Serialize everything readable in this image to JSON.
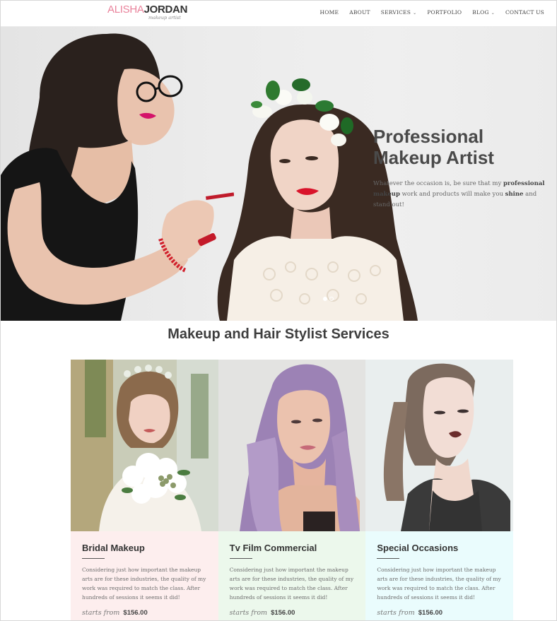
{
  "header": {
    "logo_first": "ALISHA",
    "logo_last": "JORDAN",
    "logo_tagline": "makeup artist",
    "nav": [
      {
        "label": "HOME",
        "dropdown": false
      },
      {
        "label": "ABOUT",
        "dropdown": false
      },
      {
        "label": "SERVICES",
        "dropdown": true
      },
      {
        "label": "PORTFOLIO",
        "dropdown": false
      },
      {
        "label": "BLOG",
        "dropdown": true
      },
      {
        "label": "CONTACT US",
        "dropdown": false
      }
    ]
  },
  "hero": {
    "title_line1": "Professional",
    "title_line2": "Makeup Artist",
    "text_part1": "Whatever the occasion is, be sure that my ",
    "text_bold1": "professional makeup",
    "text_part2": " work and products will make you ",
    "text_bold2": "shine",
    "text_part3": " and stand out!",
    "slide_count": 2,
    "active_slide": 1
  },
  "services": {
    "title": "Makeup and Hair Stylist Services",
    "cards": [
      {
        "title": "Bridal Makeup",
        "description": "Considering just how important the makeup arts are for these industries, the quality of my work was required to match the class. After hundreds of sessions it seems it did!",
        "price_prefix": "starts from",
        "price": "$156.00",
        "background": "#fdeeee"
      },
      {
        "title": "Tv Film Commercial",
        "description": "Considering just how important the makeup arts are for these industries, the quality of my work was required to match the class. After hundreds of sessions it seems it did!",
        "price_prefix": "starts from",
        "price": "$156.00",
        "background": "#ecf8ec"
      },
      {
        "title": "Special Occasions",
        "description": "Considering just how important the makeup arts are for these industries, the quality of my work was required to match the class. After hundreds of sessions it seems it did!",
        "price_prefix": "starts from",
        "price": "$156.00",
        "background": "#eafcfd"
      }
    ]
  },
  "colors": {
    "logo_pink": "#e9829b",
    "heading": "#3e3e3e"
  }
}
